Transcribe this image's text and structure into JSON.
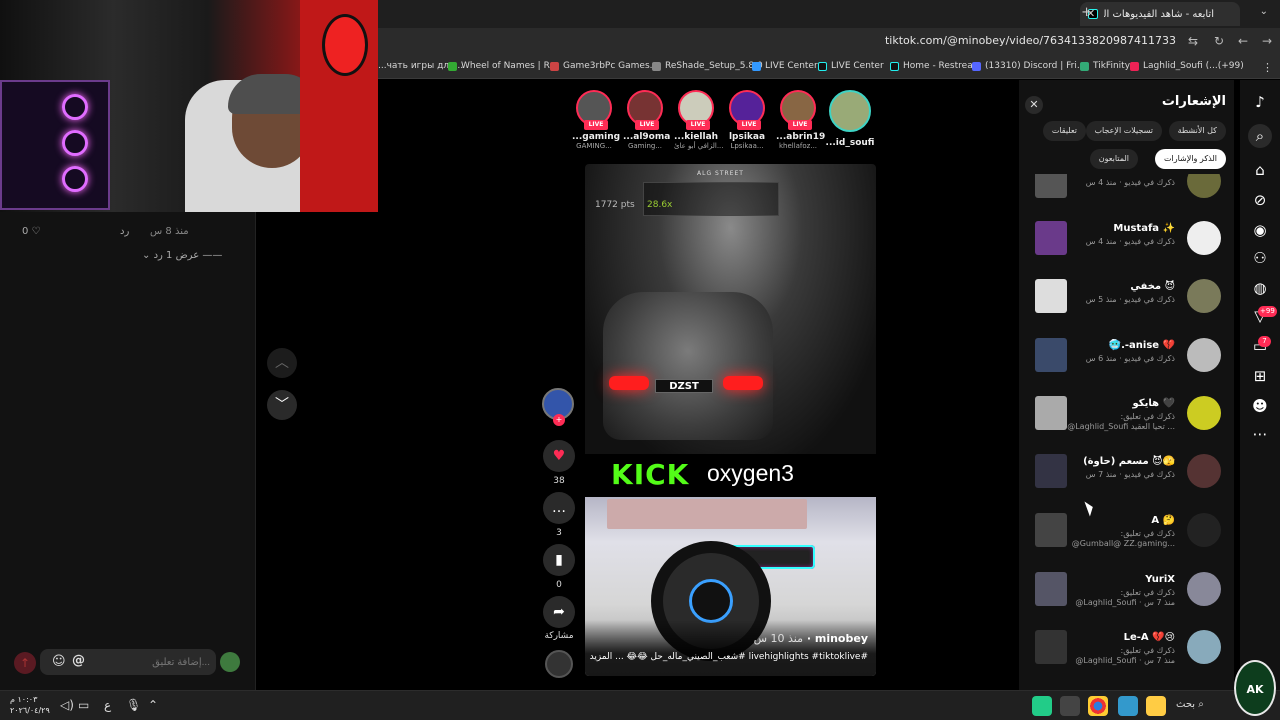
{
  "browser": {
    "tab_title": "أتابعه - شاهد الفيديوهات الخاصة...",
    "url": "tiktok.com/@minobey/video/7634133820987411733",
    "bookmarks": [
      "...чать игры для...",
      "Wheel of Names | R...",
      "Game3rbPc Games...",
      "ReShade_Setup_5.8.0",
      "LIVE Center",
      "LIVE Center",
      "Home - Restream",
      "(13310) Discord | Fri...",
      "TikFinity",
      "Laghlid_Soufi (...(+99)"
    ]
  },
  "left_panel": {
    "likes": "0",
    "time": "منذ 8 س",
    "reply": "رد",
    "view_replies": "عرض 1 رد",
    "comment_placeholder": "إضافة تعليق..."
  },
  "live_strip": [
    {
      "name": "...gaming",
      "sub": "GAMING...",
      "badge": "LIVE"
    },
    {
      "name": "...al9oma",
      "sub": "Gaming...",
      "badge": "LIVE"
    },
    {
      "name": "...kiellah",
      "sub": "الزافي أبو عائ...",
      "badge": "LIVE"
    },
    {
      "name": "lpsikaa",
      "sub": "Lpsikaa...",
      "badge": "LIVE"
    },
    {
      "name": "...abrin19",
      "sub": "khellafoz...",
      "badge": "LIVE"
    },
    {
      "name": "...id_soufi",
      "sub": "",
      "badge": ""
    }
  ],
  "video": {
    "points": "1772 pts",
    "multiplier": "28.6x",
    "street": "ALG STREET",
    "plate": "DZST",
    "kick_logo": "KICK",
    "kick_name": "oxygen3",
    "author": "minobey",
    "author_time": "منذ 10 س",
    "description": "#livehighlights #tiktoklive #شعب_الصيني_ماله_حل 😂😂 ... المزيد"
  },
  "actions": {
    "likes": "38",
    "comments": "3",
    "saves": "0",
    "share": "مشاركة"
  },
  "notifications": {
    "title": "الإشعارات",
    "tabs": [
      "كل الأنشطة",
      "تسجيلات الإعجاب",
      "تعليقات",
      "الذكر والإشارات",
      "المتابعون"
    ],
    "items": [
      {
        "name": "",
        "line1": "ذكرك في فيديو · منذ 4 س",
        "line2": ""
      },
      {
        "name": "Mustafa ✨",
        "line1": "ذكرك في فيديو · منذ 4 س",
        "line2": ""
      },
      {
        "name": "مخفي 😈",
        "line1": "ذكرك في فيديو · منذ 5 س",
        "line2": ""
      },
      {
        "name": "🥶.-anise 💔",
        "line1": "ذكرك في فيديو · منذ 6 س",
        "line2": ""
      },
      {
        "name": "هايكو 🖤",
        "line1": "ذكرك في تعليق:",
        "line2": "@Laghlid_Soufi تحيا العقيد ..."
      },
      {
        "name": "مسعم (حاوة) 😈🫣",
        "line1": "ذكرك في فيديو · منذ 7 س",
        "line2": ""
      },
      {
        "name": "A 🤔",
        "line1": "ذكرك في تعليق:",
        "line2": "@Gumball@ ZZ.gaming..."
      },
      {
        "name": "YuriX",
        "line1": "ذكرك في تعليق:",
        "line2": "@Laghlid_Soufi · منذ 7 س"
      },
      {
        "name": "Le-A 💔😢",
        "line1": "ذكرك في تعليق:",
        "line2": "@Laghlid_Soufi · منذ 7 س"
      }
    ]
  },
  "sidebar": {
    "badge_inbox": "+99",
    "badge_messages": "7"
  },
  "taskbar": {
    "time": "١٠:٠٣ م",
    "date": "٢٠٢٦/٠٤/٢٩",
    "lang": "ع",
    "search": "بحث"
  },
  "watermark": "AK"
}
